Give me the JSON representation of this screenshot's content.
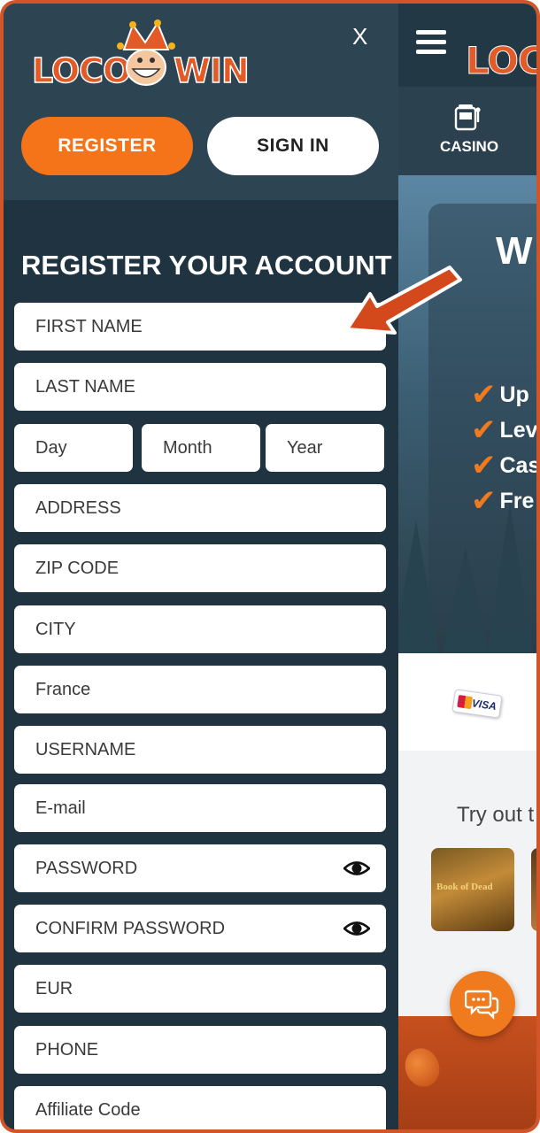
{
  "drawer": {
    "logo_left": "LOCO",
    "logo_right": "WIN",
    "close_label": "X",
    "register_label": "REGISTER",
    "signin_label": "SIGN IN"
  },
  "form": {
    "title": "REGISTER YOUR ACCOUNT",
    "fields": {
      "first_name": "FIRST NAME",
      "last_name": "LAST NAME",
      "day": "Day",
      "month": "Month",
      "year": "Year",
      "address": "ADDRESS",
      "zip": "ZIP CODE",
      "city": "CITY",
      "country": "France",
      "username": "USERNAME",
      "email": "E-mail",
      "password": "PASSWORD",
      "confirm_password": "CONFIRM PASSWORD",
      "currency": "EUR",
      "phone": "PHONE",
      "affiliate": "Affiliate Code"
    }
  },
  "background_page": {
    "logo": "LOCO",
    "nav_casino": "CASINO",
    "hero_title": "W",
    "perks": [
      "Up",
      "Lev",
      "Cas",
      "Fre"
    ],
    "visa_label": "VISA",
    "tryout_text": "Try out t",
    "thumb_caption": "Book of Dead"
  },
  "colors": {
    "accent": "#f5741a",
    "drawer_bg": "#1f3340",
    "header_bg": "#2d4453",
    "frame_border": "#d2552a"
  },
  "icons": {
    "menu": "hamburger-icon",
    "casino": "slot-machine-icon",
    "password_toggle": "eye-icon",
    "chat": "chat-bubble-icon",
    "annotation": "arrow-icon"
  }
}
